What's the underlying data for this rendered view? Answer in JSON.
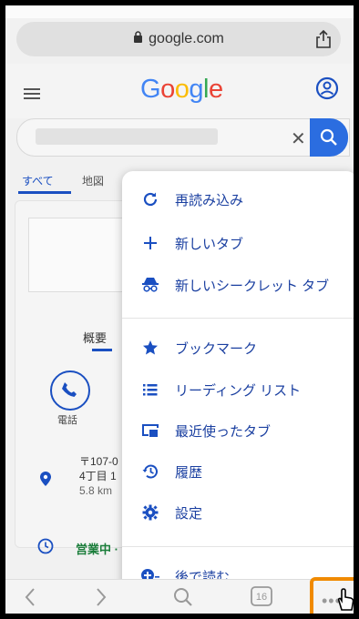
{
  "browser": {
    "url": "google.com"
  },
  "google": {
    "logo": "Google"
  },
  "tabs": [
    {
      "label": "すべて"
    },
    {
      "label": "地図"
    }
  ],
  "result": {
    "overview": "概要",
    "call": "電話",
    "address": [
      "〒107-0",
      "4丁目 1"
    ],
    "distance": "5.8 km",
    "hours": "営業中 ·"
  },
  "menu": {
    "items": [
      {
        "icon": "reload-icon",
        "label": "再読み込み"
      },
      {
        "icon": "plus-icon",
        "label": "新しいタブ"
      },
      {
        "icon": "incognito-icon",
        "label": "新しいシークレット タブ"
      },
      {
        "icon": "star-icon",
        "label": "ブックマーク"
      },
      {
        "icon": "list-icon",
        "label": "リーディング リスト"
      },
      {
        "icon": "recent-tabs-icon",
        "label": "最近使ったタブ"
      },
      {
        "icon": "history-icon",
        "label": "履歴"
      },
      {
        "icon": "settings-gear-icon",
        "label": "設定"
      },
      {
        "icon": "read-later-icon",
        "label": "後で読む"
      }
    ]
  },
  "toolbar": {
    "tab_count": "16",
    "more_label": "•••"
  },
  "colors": {
    "accent": "#1a4fc1",
    "highlight": "#f08a00",
    "open_green": "#1a7d3a"
  }
}
